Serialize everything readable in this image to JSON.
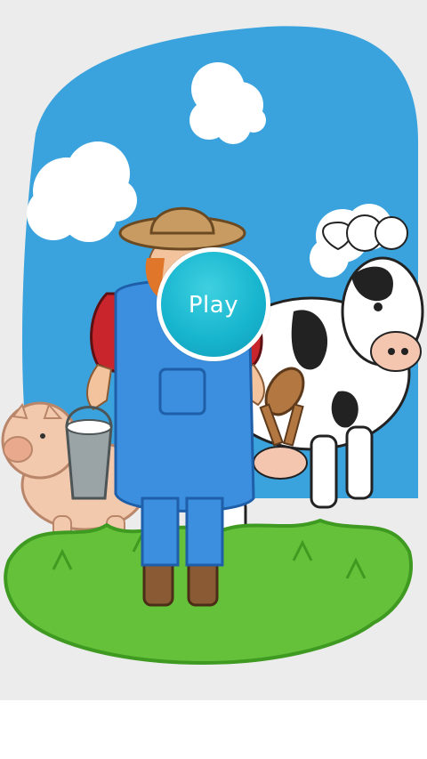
{
  "menu": {
    "play_label": "Play"
  },
  "colors": {
    "sky": "#3aa3de",
    "grass": "#66c13a",
    "grass_dark": "#3e9a20",
    "play_button": "#18b6cf",
    "background": "#ececec"
  },
  "scene": {
    "characters": [
      "farmer",
      "cow",
      "pig"
    ],
    "icons": [
      "cloud-icon",
      "milk-bucket-icon",
      "milking-stool-icon"
    ]
  }
}
